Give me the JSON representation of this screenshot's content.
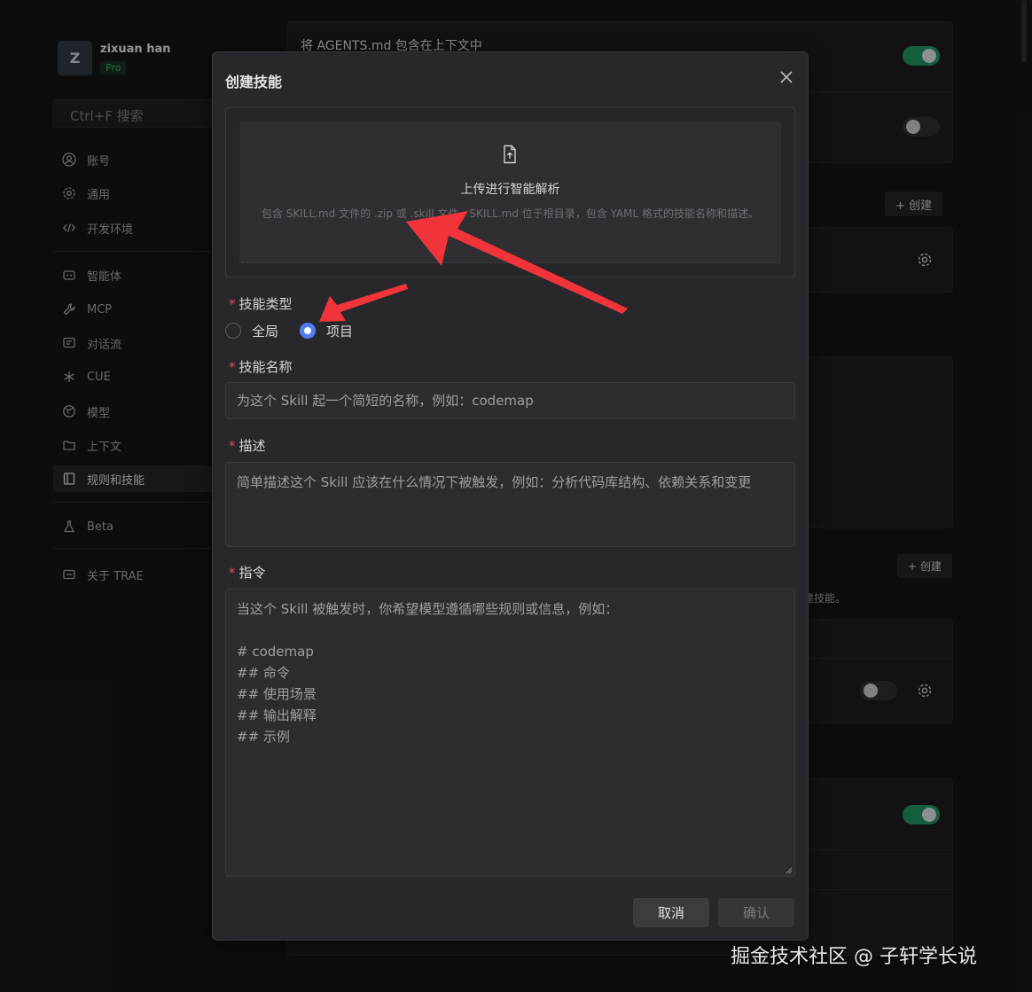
{
  "user": {
    "initial": "Z",
    "name": "zixuan han",
    "plan": "Pro"
  },
  "search": {
    "placeholder": "Ctrl+F 搜索"
  },
  "nav": {
    "account": "账号",
    "general": "通用",
    "dev_env": "开发环境",
    "agents": "智能体",
    "mcp": "MCP",
    "flow": "对话流",
    "cue": "CUE",
    "models": "模型",
    "context": "上下文",
    "rules_skills": "规则和技能",
    "beta": "Beta",
    "about": "关于 TRAE"
  },
  "background": {
    "agents_md_label": "将 AGENTS.md 包含在上下文中",
    "create_button": "+ 创建",
    "create_button_small": "+ 创建",
    "skills_hint": "建技能。"
  },
  "dialog": {
    "title": "创建技能",
    "upload": {
      "title": "上传进行智能解析",
      "description": "包含 SKILL.md 文件的 .zip 或 .skill 文件，SKILL.md 位于根目录，包含 YAML 格式的技能名称和描述。"
    },
    "skill_type": {
      "label": "技能类型",
      "required_mark": "*",
      "options": [
        "全局",
        "项目"
      ],
      "selected": "项目"
    },
    "skill_name": {
      "label": "技能名称",
      "required_mark": "*",
      "placeholder": "为这个 Skill 起一个简短的名称，例如：codemap"
    },
    "description": {
      "label": "描述",
      "required_mark": "*",
      "placeholder": "简单描述这个 Skill 应该在什么情况下被触发，例如：分析代码库结构、依赖关系和变更"
    },
    "instruction": {
      "label": "指令",
      "required_mark": "*",
      "placeholder": "当这个 Skill 被触发时，你希望模型遵循哪些规则或信息，例如：\n\n# codemap\n## 命令\n## 使用场景\n## 输出解释\n## 示例"
    },
    "cancel_label": "取消",
    "confirm_label": "确认"
  },
  "watermark": "掘金技术社区 @ 子轩学长说",
  "colors": {
    "accent": "#4f7df2",
    "toggle_on": "#1f8a5d",
    "required": "#e0504e",
    "annotation_arrow": "#f0343a"
  }
}
